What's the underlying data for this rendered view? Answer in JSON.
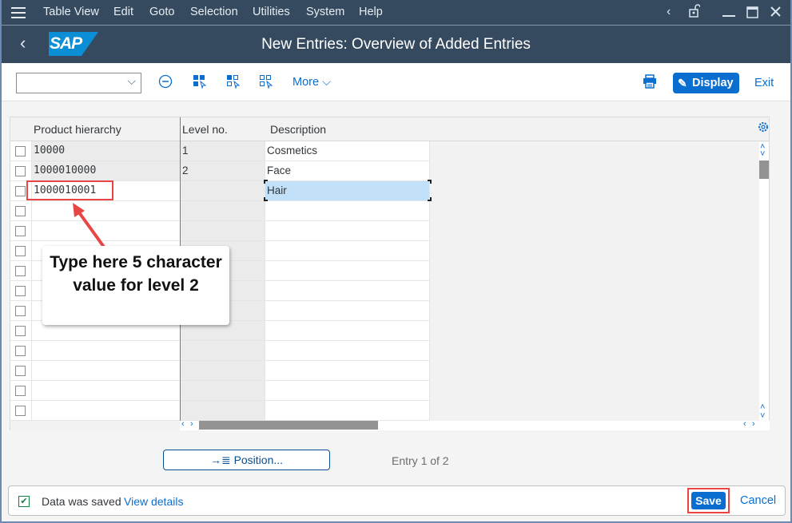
{
  "menubar": {
    "items": [
      "Table View",
      "Edit",
      "Goto",
      "Selection",
      "Utilities",
      "System",
      "Help"
    ]
  },
  "titlebar": {
    "logo": "SAP",
    "title": "New Entries: Overview of Added Entries"
  },
  "toolbar": {
    "dropdown_value": "",
    "more_label": "More",
    "display_label": "Display",
    "exit_label": "Exit",
    "icons": [
      "deselect-icon",
      "select-all-icon",
      "select-block-icon",
      "deselect-all-icon",
      "print-icon",
      "display-change-icon"
    ]
  },
  "table": {
    "columns": [
      "Product hierarchy",
      "Level no.",
      "Description"
    ],
    "rows": [
      {
        "product_hierarchy": "10000",
        "level": "1",
        "description": "Cosmetics"
      },
      {
        "product_hierarchy": "1000010000",
        "level": "2",
        "description": "Face"
      },
      {
        "product_hierarchy": "1000010001",
        "level": "",
        "description": "Hair"
      },
      {
        "product_hierarchy": "",
        "level": "",
        "description": ""
      },
      {
        "product_hierarchy": "",
        "level": "",
        "description": ""
      },
      {
        "product_hierarchy": "",
        "level": "",
        "description": ""
      },
      {
        "product_hierarchy": "",
        "level": "",
        "description": ""
      },
      {
        "product_hierarchy": "",
        "level": "",
        "description": ""
      },
      {
        "product_hierarchy": "",
        "level": "",
        "description": ""
      },
      {
        "product_hierarchy": "",
        "level": "",
        "description": ""
      },
      {
        "product_hierarchy": "",
        "level": "",
        "description": ""
      },
      {
        "product_hierarchy": "",
        "level": "",
        "description": ""
      },
      {
        "product_hierarchy": "",
        "level": "",
        "description": ""
      },
      {
        "product_hierarchy": "",
        "level": "",
        "description": ""
      }
    ]
  },
  "annotation": {
    "callout_text": "Type here 5 character value for level 2"
  },
  "footer": {
    "position_label": "Position...",
    "entry_info": "Entry 1 of 2"
  },
  "statusbar": {
    "message": "Data was saved",
    "details_link": "View details",
    "save_label": "Save",
    "cancel_label": "Cancel"
  },
  "colors": {
    "shell": "#354a5f",
    "accent": "#0a6ed1",
    "annotation": "#e84545",
    "success": "#107e3e"
  }
}
